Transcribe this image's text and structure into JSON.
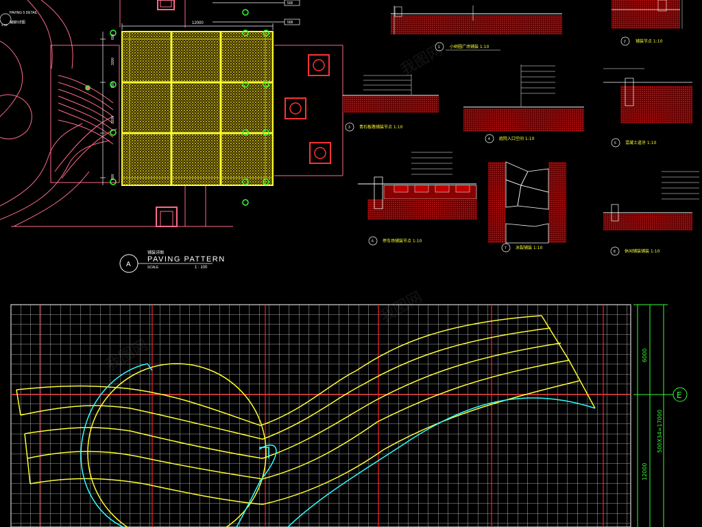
{
  "paving_plan": {
    "title_cn": "铺装详图",
    "title_en": "PAVING PATTERN",
    "scale_label": "SCALE",
    "scale_value": "1 : 100",
    "ref_letter": "A",
    "corner_label": "PAVING 5 DETAIL",
    "corner_cn": "铺装5详图",
    "corner_ref": "3.05",
    "dim_top": "12000",
    "dim_left": [
      "800",
      "3200",
      "800",
      "3200",
      "800"
    ],
    "callouts": [
      "506",
      "568"
    ]
  },
  "sections": [
    {
      "num": "1",
      "title": "小树圆广场铺装  1:10"
    },
    {
      "num": "2",
      "title": "铺装节点  1:10"
    },
    {
      "num": "3",
      "title": "青石板路铺装节点  1:10"
    },
    {
      "num": "4",
      "title": "庭院入口空间  1:10"
    },
    {
      "num": "5",
      "title": "混凝土道牙  1:10"
    },
    {
      "num": "6",
      "title": "停车场铺装节点  1:10"
    },
    {
      "num": "7",
      "title": "冰裂铺装  1:10"
    },
    {
      "num": "8",
      "title": "休闲铺装铺装  1:10"
    }
  ],
  "grid_plan": {
    "dim_upper": "6000",
    "dim_lower": "12000",
    "dim_total": "500X34=17000",
    "axis_label": "E"
  },
  "watermark": "我图网"
}
